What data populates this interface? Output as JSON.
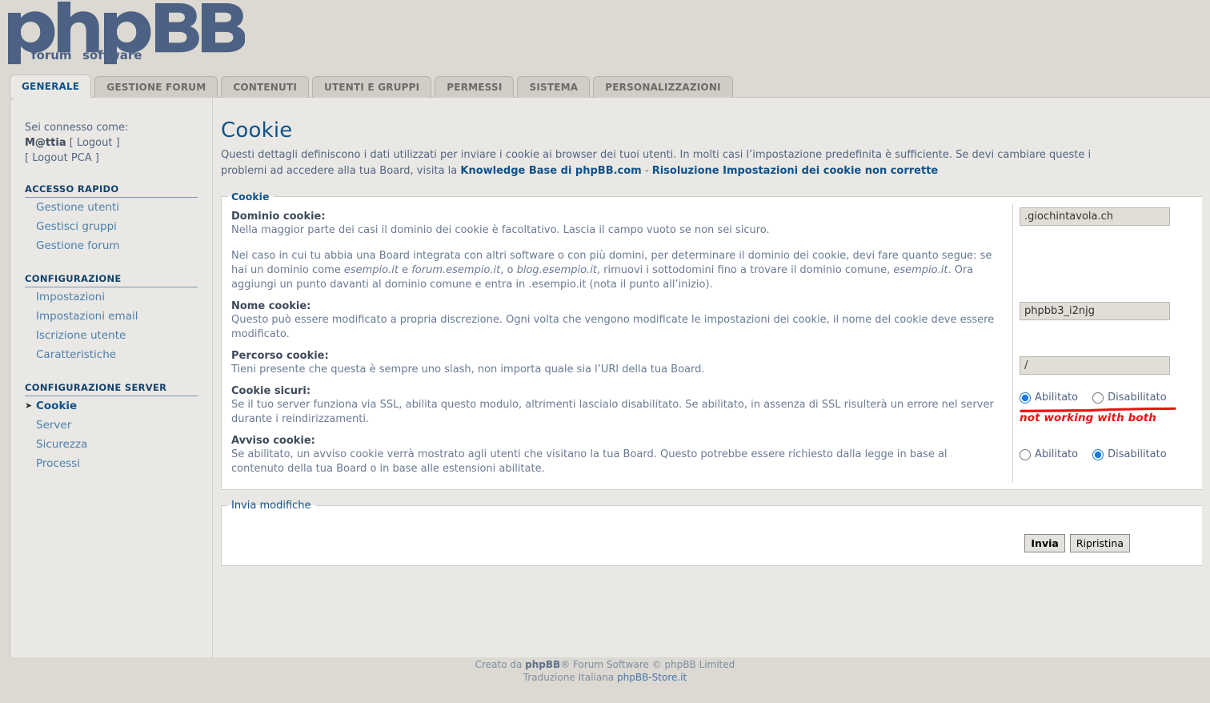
{
  "brand": {
    "name": "phpBB",
    "tagline_left": "forum",
    "tagline_right": "software",
    "registered_mark": "®"
  },
  "tabs": [
    {
      "label": "GENERALE",
      "active": true
    },
    {
      "label": "GESTIONE FORUM",
      "active": false
    },
    {
      "label": "CONTENUTI",
      "active": false
    },
    {
      "label": "UTENTI E GRUPPI",
      "active": false
    },
    {
      "label": "PERMESSI",
      "active": false
    },
    {
      "label": "SISTEMA",
      "active": false
    },
    {
      "label": "PERSONALIZZAZIONI",
      "active": false
    }
  ],
  "sidebar": {
    "connected_as_label": "Sei connesso come:",
    "username": "M@ttia",
    "logout_label": "[ Logout ]",
    "logout_pca_label": "[ Logout PCA ]",
    "sections": [
      {
        "heading": "ACCESSO RAPIDO",
        "items": [
          {
            "label": "Gestione utenti",
            "active": false
          },
          {
            "label": "Gestisci gruppi",
            "active": false
          },
          {
            "label": "Gestione forum",
            "active": false
          }
        ]
      },
      {
        "heading": "CONFIGURAZIONE",
        "items": [
          {
            "label": "Impostazioni",
            "active": false
          },
          {
            "label": "Impostazioni email",
            "active": false
          },
          {
            "label": "Iscrizione utente",
            "active": false
          },
          {
            "label": "Caratteristiche",
            "active": false
          }
        ]
      },
      {
        "heading": "CONFIGURAZIONE SERVER",
        "items": [
          {
            "label": "Cookie",
            "active": true
          },
          {
            "label": "Server",
            "active": false
          },
          {
            "label": "Sicurezza",
            "active": false
          },
          {
            "label": "Processi",
            "active": false
          }
        ]
      }
    ]
  },
  "page": {
    "title": "Cookie",
    "desc_part1": "Questi dettagli definiscono i dati utilizzati per inviare i cookie ai browser dei tuoi utenti. In molti casi l’impostazione predefinita è sufficiente. Se devi cambiare queste i",
    "desc_part2_pre": "problemi ad accedere alla tua Board, visita la ",
    "desc_link_a": "Knowledge Base di phpBB.com",
    "desc_sep": " - ",
    "desc_link_b": "Risoluzione Impostazioni dei cookie non corrette"
  },
  "fieldset": {
    "legend": "Cookie",
    "fields": {
      "domain": {
        "label": "Dominio cookie:",
        "desc1": "Nella maggior parte dei casi il dominio dei cookie è facoltativo. Lascia il campo vuoto se non sei sicuro.",
        "desc2_a": "Nel caso in cui tu abbia una Board integrata con altri software o con più domini, per determinare il dominio dei cookie, devi fare quanto segue: se hai un dominio come ",
        "desc2_em1": "esempio.it",
        "desc2_b": " e ",
        "desc2_em2": "forum.esempio.it",
        "desc2_c": ", o ",
        "desc2_em3": "blog.esempio.it",
        "desc2_d": ", rimuovi i sottodomini fino a trovare il dominio comune, ",
        "desc2_em4": "esempio.it",
        "desc2_e": ". Ora aggiungi un punto davanti al dominio comune e entra in .esempio.it (nota il punto all’inizio).",
        "value": ".giochintavola.ch"
      },
      "name": {
        "label": "Nome cookie:",
        "desc": "Questo può essere modificato a propria discrezione. Ogni volta che vengono modificate le impostazioni dei cookie, il nome del cookie deve essere modificato.",
        "value": "phpbb3_i2njg"
      },
      "path": {
        "label": "Percorso cookie:",
        "desc": "Tieni presente che questa è sempre uno slash, non importa quale sia l’URl della tua Board.",
        "value": "/"
      },
      "secure": {
        "label": "Cookie sicuri:",
        "desc": "Se il tuo server funziona via SSL, abilita questo modulo, altrimenti lascialo disabilitato. Se abilitato, in assenza di SSL risulterà un errore nel server durante i reindirizzamenti.",
        "option_enabled": "Abilitato",
        "option_disabled": "Disabilitato",
        "selected": "enabled",
        "annotation": "not working with both"
      },
      "notice": {
        "label": "Avviso cookie:",
        "desc": "Se abilitato, un avviso cookie verrà mostrato agli utenti che visitano la tua Board. Questo potrebbe essere richiesto dalla legge in base al contenuto della tua Board o in base alle estensioni abilitate.",
        "option_enabled": "Abilitato",
        "option_disabled": "Disabilitato",
        "selected": "disabled"
      }
    }
  },
  "submit": {
    "legend": "Invia modifiche",
    "submit_label": "Invia",
    "reset_label": "Ripristina"
  },
  "footer": {
    "line1_pre": "Creato da ",
    "line1_brand": "phpBB",
    "line1_post": "® Forum Software © phpBB Limited",
    "line2_pre": "Traduzione Italiana ",
    "line2_link": "phpBB-Store.it"
  },
  "colors": {
    "accent": "#105289",
    "link": "#4c7faf",
    "annotation": "#ee1111",
    "page_bg": "#dbd9d2",
    "panel_bg": "#e9e8e4"
  }
}
